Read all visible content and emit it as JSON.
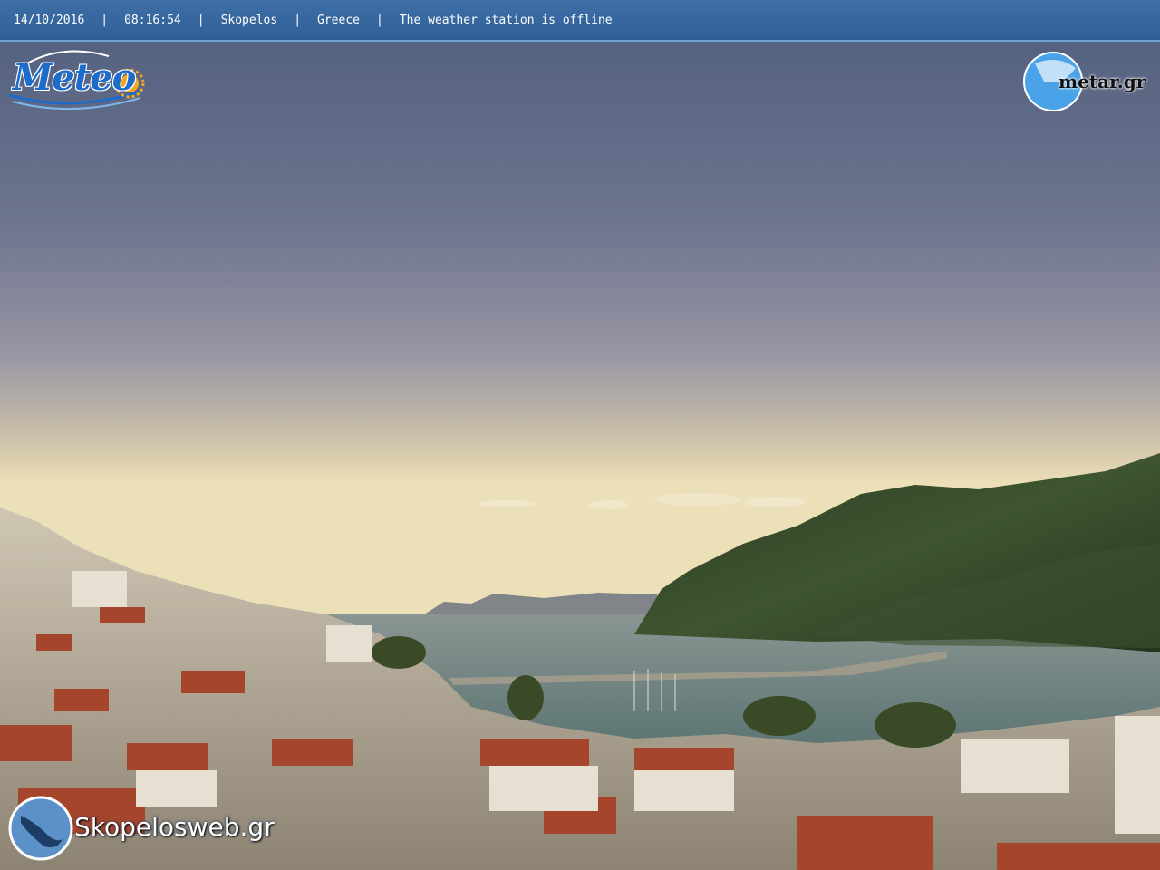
{
  "status_bar": {
    "date": "14/10/2016",
    "time": "08:16:54",
    "location": "Skopelos",
    "country": "Greece",
    "status": "The weather station is offline",
    "separator": "|"
  },
  "logos": {
    "meteo": "Meteo",
    "metar": "metar.gr",
    "skopelosweb": "Skopelosweb.gr"
  },
  "colors": {
    "bar": "#2e5f97",
    "sky_top": "#5b6b87",
    "sky_horizon": "#e9dcb2",
    "sea": "#4f6b68"
  }
}
